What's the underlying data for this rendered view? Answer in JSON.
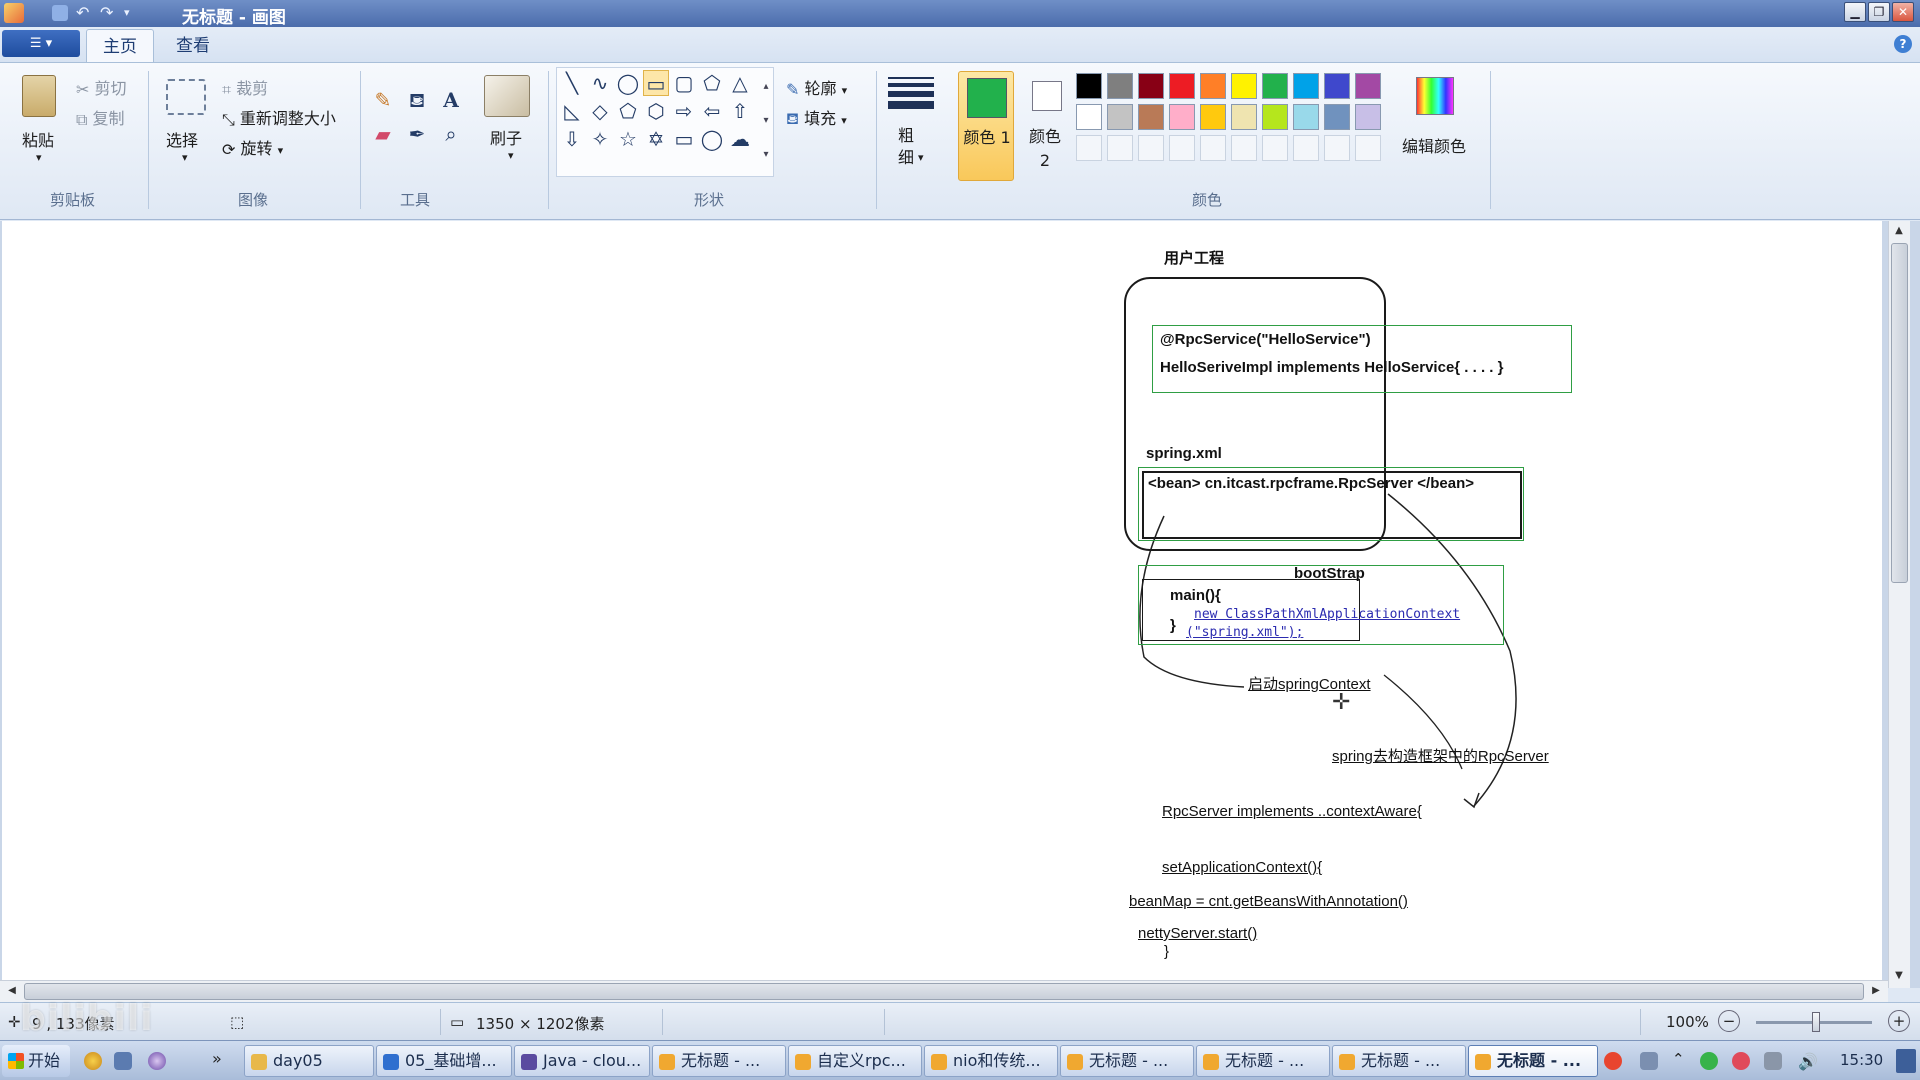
{
  "window": {
    "title": "无标题 - 画图"
  },
  "tabs": [
    {
      "label": "主页",
      "active": true
    },
    {
      "label": "查看",
      "active": false
    }
  ],
  "ribbon": {
    "clipboard": {
      "label": "剪贴板",
      "paste": "粘贴",
      "cut": "剪切",
      "copy": "复制"
    },
    "image": {
      "label": "图像",
      "select": "选择",
      "crop": "裁剪",
      "resize": "重新调整大小",
      "rotate": "旋转"
    },
    "tools": {
      "label": "工具"
    },
    "brushes": {
      "label": "刷子"
    },
    "shapes": {
      "label": "形状",
      "outline": "轮廓",
      "fill": "填充"
    },
    "size": {
      "label": "粗细"
    },
    "colors": {
      "label": "颜色",
      "color1": "颜色 1",
      "color2": "颜色 2",
      "edit": "编辑颜色",
      "color1_value": "#22b14c",
      "color2_value": "#ffffff",
      "row1": [
        "#000000",
        "#7f7f7f",
        "#880015",
        "#ed1c24",
        "#ff7f27",
        "#fff200",
        "#22b14c",
        "#00a2e8",
        "#3f48cc",
        "#a349a4"
      ],
      "row2": [
        "#ffffff",
        "#c3c3c3",
        "#b97a57",
        "#ffaec9",
        "#ffc90e",
        "#efe4b0",
        "#b5e61d",
        "#99d9ea",
        "#7092be",
        "#c8bfe7"
      ]
    }
  },
  "diagram": {
    "user_project": "用户工程",
    "rpc_service_line": "@RpcService(\"HelloService\")",
    "impl_line": "HelloSeriveImpl  implements HelloService{ . . . . }",
    "spring_xml_label": "spring.xml",
    "bean_line": "<bean> cn.itcast.rpcframe.RpcServer </bean>",
    "bootstrap_label": "bootStrap",
    "main_line": "main(){",
    "new_ctx_line": "new ClassPathXmlApplicationContext",
    "spring_xml_arg": "(\"spring.xml\");",
    "close_brace": "}",
    "start_ctx": "启动springContext",
    "spring_build": "spring去构造框架中的RpcServer",
    "rpcserver_impl": "RpcServer implements ..contextAware{",
    "set_ctx": "setApplicationContext(){",
    "beanmap": "beanMap = cnt.getBeansWithAnnotation()",
    "netty": "nettyServer.start()",
    "brace2": "}"
  },
  "status": {
    "cursor_pos": "9",
    "cursor_suffix": "133像素",
    "canvas_size": "1350 × 1202像素",
    "zoom": "100%"
  },
  "taskbar": {
    "start": "开始",
    "items": [
      {
        "label": "day05",
        "color": "#e8b84a"
      },
      {
        "label": "05_基础增...",
        "color": "#2f6fcf"
      },
      {
        "label": "Java - clou...",
        "color": "#5a4aa0"
      },
      {
        "label": "无标题 - ...",
        "color": "#f0a830"
      },
      {
        "label": "自定义rpc...",
        "color": "#f0a830"
      },
      {
        "label": "nio和传统...",
        "color": "#f0a830"
      },
      {
        "label": "无标题 - ...",
        "color": "#f0a830"
      },
      {
        "label": "无标题 - ...",
        "color": "#f0a830"
      },
      {
        "label": "无标题 - ...",
        "color": "#f0a830"
      },
      {
        "label": "无标题 - ...",
        "color": "#f0a830",
        "active": true
      }
    ],
    "clock": "15:30"
  },
  "watermark": "bilibili"
}
